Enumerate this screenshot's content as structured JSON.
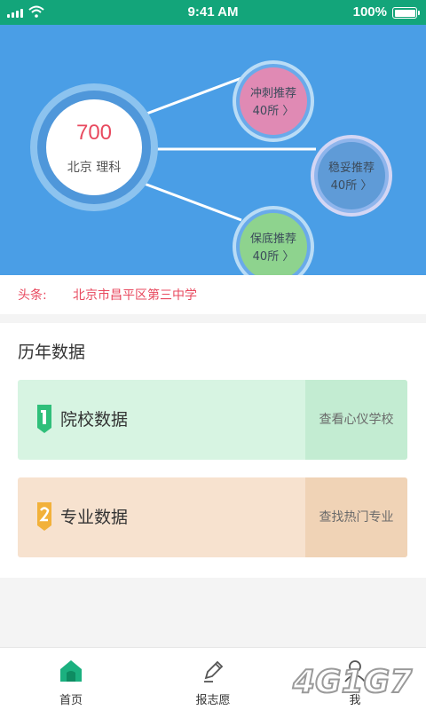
{
  "status_bar": {
    "time": "9:41 AM",
    "battery": "100%"
  },
  "score": {
    "value": "700",
    "subtitle": "北京 理科"
  },
  "recommendations": [
    {
      "label": "冲刺推荐",
      "count": "40所 〉"
    },
    {
      "label": "稳妥推荐",
      "count": "40所 〉"
    },
    {
      "label": "保底推荐",
      "count": "40所 〉"
    }
  ],
  "headline": {
    "label": "头条:",
    "text": "北京市昌平区第三中学"
  },
  "history": {
    "title": "历年数据",
    "cards": [
      {
        "title": "院校数据",
        "action": "查看心仪学校",
        "badge": "1"
      },
      {
        "title": "专业数据",
        "action": "查找热门专业",
        "badge": "2"
      }
    ]
  },
  "tabs": [
    {
      "label": "首页"
    },
    {
      "label": "报志愿"
    },
    {
      "label": "我"
    }
  ],
  "colors": {
    "status_bar": "#13a57a",
    "hero": "#4a9ee6",
    "accent_red": "#e84a5f",
    "rush": "#e08ab4",
    "safe": "#5f9bd7",
    "base": "#8ed38e"
  },
  "watermark": "4G1G7"
}
